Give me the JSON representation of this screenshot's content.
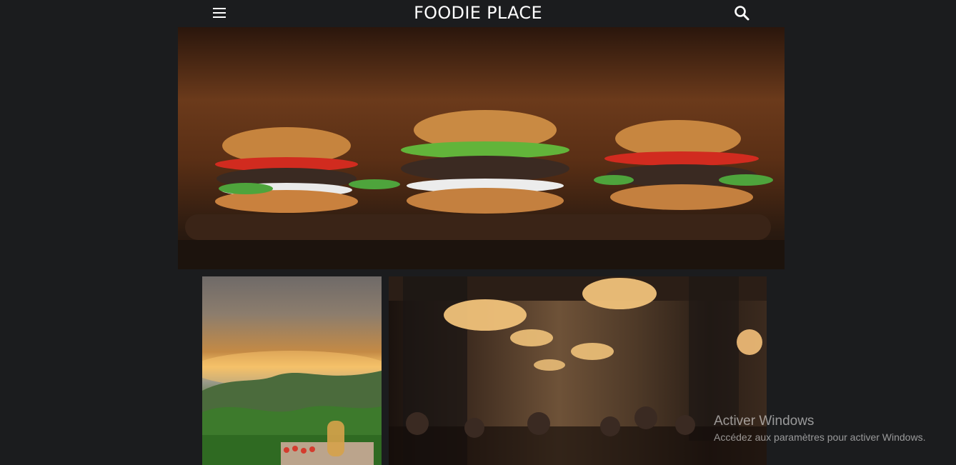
{
  "header": {
    "brand": "FOODIE PLACE",
    "menu_icon": "hamburger-menu-icon",
    "search_icon": "search-icon"
  },
  "gallery": {
    "hero": {
      "description": "burgers-on-wooden-board"
    },
    "secondary": [
      {
        "description": "countryside-sunset-with-tomatoes-and-oil"
      },
      {
        "description": "restaurant-dining-room-with-chandeliers"
      }
    ]
  },
  "os_overlay": {
    "title": "Activer Windows",
    "subtitle": "Accédez aux paramètres pour activer Windows."
  },
  "colors": {
    "background": "#1b1c1e",
    "text": "#ffffff"
  }
}
